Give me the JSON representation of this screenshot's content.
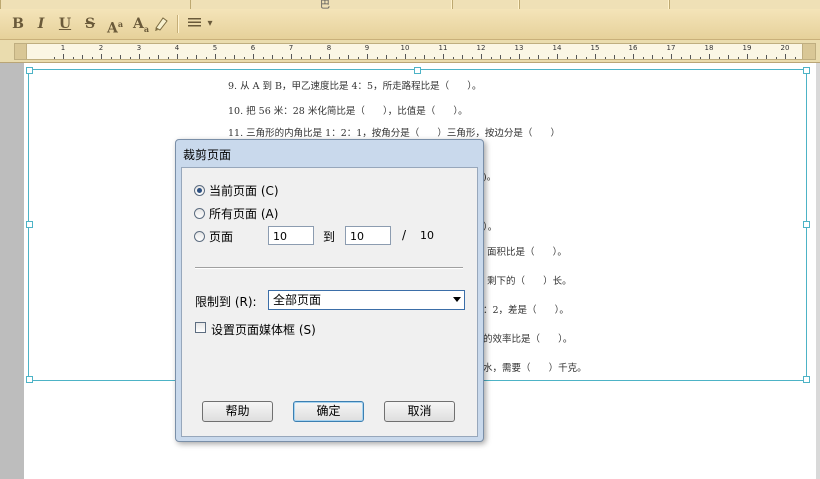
{
  "topbar": {
    "mark": "巴"
  },
  "toolbar": {
    "bold": "B",
    "italic": "I",
    "underline": "U",
    "strike": "S",
    "superscript_base": "A",
    "superscript_mark": "a",
    "subscript_base": "A",
    "subscript_mark": "a",
    "highlighter_icon": "highlighter-icon",
    "align_icon": "align-lines-icon",
    "dropdown_icon": "▾"
  },
  "ruler": {
    "numbers": [
      "1",
      "2",
      "3",
      "4",
      "5",
      "6",
      "7",
      "8",
      "9",
      "10",
      "11",
      "12",
      "13",
      "14",
      "15",
      "16",
      "17",
      "18",
      "19",
      "20"
    ]
  },
  "document": {
    "lines": [
      "9. 从 A 到 B，甲乙速度比是 4：5，所走路程比是（      ）。",
      "10. 把 56 米：28 米化简比是（      ），比值是（      ）。",
      "11. 三角形的内角比是 1：2：1，按角分是（      ）三角形，按边分是（      ）",
      "面积比是（      ）。",
      "剩下的（      ）长。",
      "：2，差是（      ）。",
      "的效率比是（      ）。",
      "水，需要（      ）千克。"
    ],
    "partial_fragments": [
      ")。",
      "）。"
    ]
  },
  "dialog": {
    "title": "裁剪页面",
    "radio_current": "当前页面 (C)",
    "radio_all": "所有页面 (A)",
    "radio_pages": "页面",
    "from_value": "10",
    "to_label": "到",
    "to_value": "10",
    "slash": "/",
    "total_pages": "10",
    "limit_label": "限制到 (R):",
    "limit_value": "全部页面",
    "mediabox_label": "设置页面媒体框 (S)",
    "help_button": "帮助",
    "ok_button": "确定",
    "cancel_button": "取消",
    "selected_option": "current"
  }
}
